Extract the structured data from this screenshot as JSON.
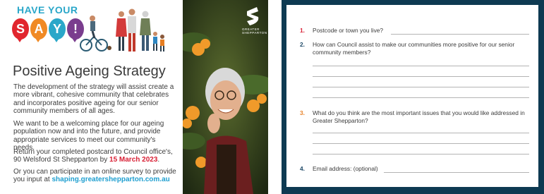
{
  "front": {
    "badge_top": "HAVE YOUR",
    "badge_letters": [
      "S",
      "A",
      "Y",
      "!"
    ],
    "badge_colors": [
      "#e1262e",
      "#f08a25",
      "#2aa7c9",
      "#7a3d8e"
    ],
    "brand_name_line1": "GREATER",
    "brand_name_line2": "SHEPPARTON",
    "title": "Positive Ageing Strategy",
    "para1": "The development of the strategy will assist create a more vibrant, cohesive community that celebrates and incorporates positive ageing for our senior community members of all ages.",
    "para2": "We want to be a welcoming place for our ageing population now and into the future, and provide appropriate services to meet our community's needs.",
    "para3_a": "Return your completed postcard to Council office's, 90 Welsford St Shepparton by ",
    "para3_date": "15 March 2023",
    "para3_b": ".",
    "para4_a": "Or you can participate in an online survey to provide you input at ",
    "para4_url": "shaping.greatershepparton.com.au"
  },
  "back": {
    "q1_num": "1.",
    "q1_text": "Postcode or town you live?",
    "q2_num": "2.",
    "q2_text": "How can Council assist to make our communities more positive for our senior community members?",
    "q3_num": "3.",
    "q3_text": "What do you think are the most important issues that you would like addressed in Greater Shepparton?",
    "q4_num": "4.",
    "q4_text": "Email address: (optional)"
  }
}
